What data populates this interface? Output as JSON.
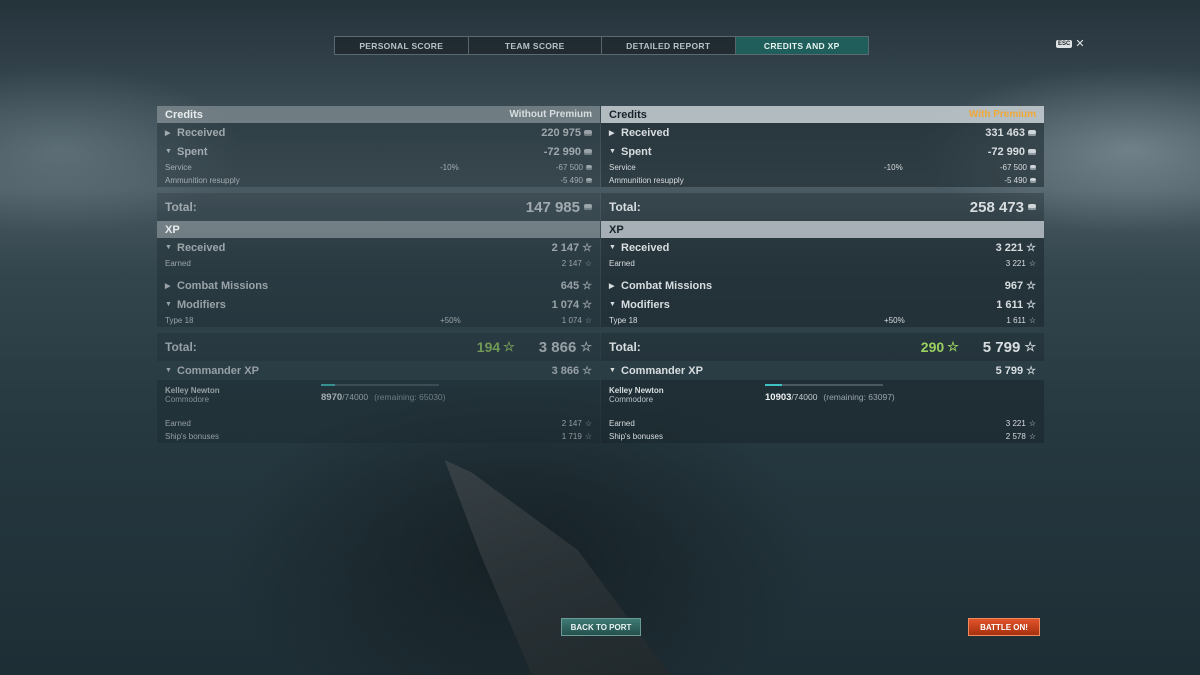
{
  "tabs": [
    "PERSONAL SCORE",
    "TEAM SCORE",
    "DETAILED REPORT",
    "CREDITS AND XP"
  ],
  "esc_label": "ESC",
  "close_glyph": "✕",
  "left": {
    "credits_title": "Credits",
    "premium_label": "Without Premium",
    "received_label": "Received",
    "received_value": "220 975",
    "spent_label": "Spent",
    "spent_value": "-72 990",
    "service_label": "Service",
    "service_pct": "-10%",
    "service_value": "-67 500",
    "ammo_label": "Ammunition resupply",
    "ammo_value": "-5 490",
    "credits_total_label": "Total:",
    "credits_total_value": "147 985",
    "xp_title": "XP",
    "xp_received_label": "Received",
    "xp_received_value": "2 147",
    "earned_label": "Earned",
    "earned_value": "2 147",
    "missions_label": "Combat Missions",
    "missions_value": "645",
    "modifiers_label": "Modifiers",
    "modifiers_value": "1 074",
    "type_label": "Type 18",
    "type_pct": "+50%",
    "type_value": "1 074",
    "xp_total_label": "Total:",
    "xp_total_premium": "194",
    "xp_total_value": "3 866",
    "commander_label": "Commander XP",
    "commander_value": "3 866",
    "commander_name": "Kelley Newton",
    "commander_rank": "Commodore",
    "commander_xp": "8970",
    "commander_xp_max": "/74000",
    "commander_remaining": "(remaining: 65030)",
    "commander_progress": 0.121,
    "cmd_earned_label": "Earned",
    "cmd_earned_value": "2 147",
    "bonus_label": "Ship's bonuses",
    "bonus_value": "1 719"
  },
  "right": {
    "credits_title": "Credits",
    "premium_label": "With Premium",
    "received_label": "Received",
    "received_value": "331 463",
    "spent_label": "Spent",
    "spent_value": "-72 990",
    "service_label": "Service",
    "service_pct": "-10%",
    "service_value": "-67 500",
    "ammo_label": "Ammunition resupply",
    "ammo_value": "-5 490",
    "credits_total_label": "Total:",
    "credits_total_value": "258 473",
    "xp_title": "XP",
    "xp_received_label": "Received",
    "xp_received_value": "3 221",
    "earned_label": "Earned",
    "earned_value": "3 221",
    "missions_label": "Combat Missions",
    "missions_value": "967",
    "modifiers_label": "Modifiers",
    "modifiers_value": "1 611",
    "type_label": "Type 18",
    "type_pct": "+50%",
    "type_value": "1 611",
    "xp_total_label": "Total:",
    "xp_total_premium": "290",
    "xp_total_value": "5 799",
    "commander_label": "Commander XP",
    "commander_value": "5 799",
    "commander_name": "Kelley Newton",
    "commander_rank": "Commodore",
    "commander_xp": "10903",
    "commander_xp_max": "/74000",
    "commander_remaining": "(remaining: 63097)",
    "commander_progress": 0.147,
    "cmd_earned_label": "Earned",
    "cmd_earned_value": "3 221",
    "bonus_label": "Ship's bonuses",
    "bonus_value": "2 578"
  },
  "buttons": {
    "back_to_port": "BACK TO PORT",
    "battle_on": "BATTLE ON!"
  },
  "colors": {
    "active_tab": "#1f5e5a",
    "premium_gold": "#f0a838",
    "xp_green": "#9ad060",
    "battle_button": "#d8441d",
    "port_button": "#2f6460",
    "progress_fill": "#3fc1c0"
  }
}
